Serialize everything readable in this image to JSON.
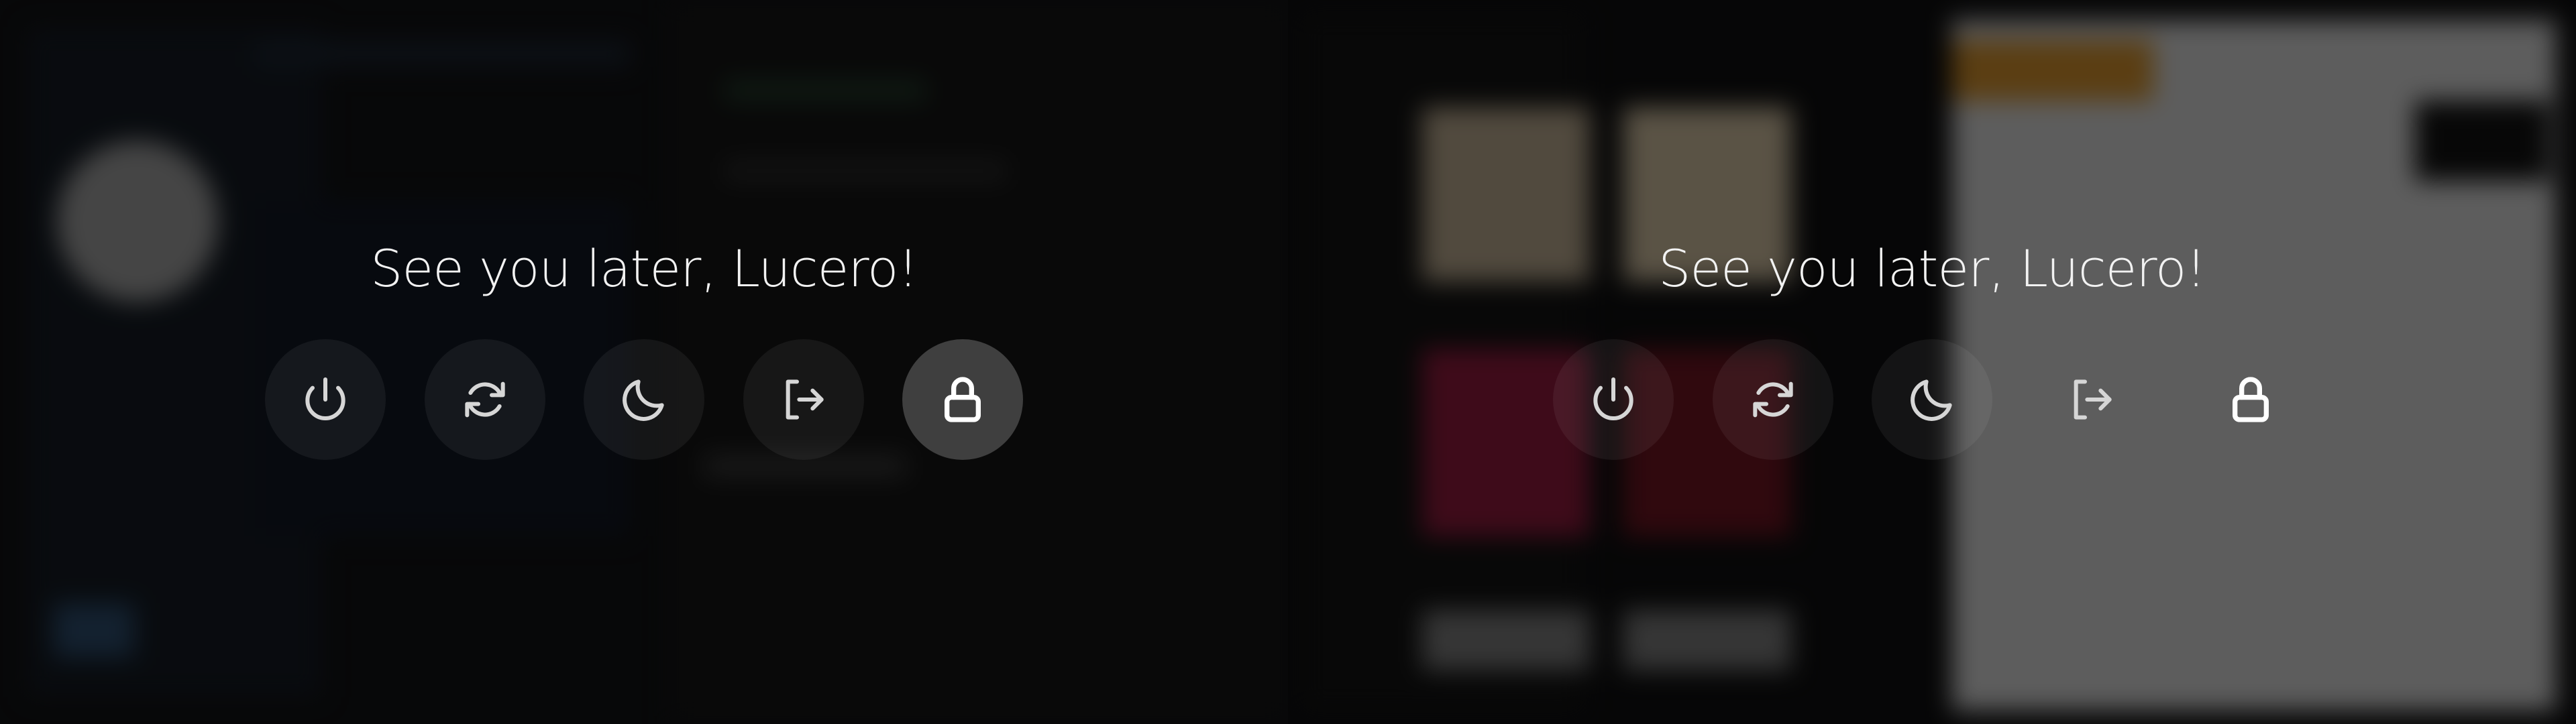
{
  "screens": [
    {
      "greeting": "See you later, Lucero!",
      "actions": [
        {
          "id": "shutdown",
          "icon": "power-icon"
        },
        {
          "id": "reboot",
          "icon": "refresh-icon"
        },
        {
          "id": "suspend",
          "icon": "moon-icon"
        },
        {
          "id": "logout",
          "icon": "logout-icon"
        },
        {
          "id": "lock",
          "icon": "lock-icon",
          "selected": true
        }
      ]
    },
    {
      "greeting": "See you later, Lucero!",
      "actions": [
        {
          "id": "shutdown",
          "icon": "power-icon"
        },
        {
          "id": "reboot",
          "icon": "refresh-icon"
        },
        {
          "id": "suspend",
          "icon": "moon-icon"
        },
        {
          "id": "logout",
          "icon": "logout-icon"
        },
        {
          "id": "lock",
          "icon": "lock-icon",
          "selected": false
        }
      ]
    }
  ],
  "colors": {
    "text": "#f2f2f2",
    "button_bg": "#1a1a1a",
    "button_selected_bg": "#4a4a4a",
    "icon": "#d6d6d6"
  }
}
